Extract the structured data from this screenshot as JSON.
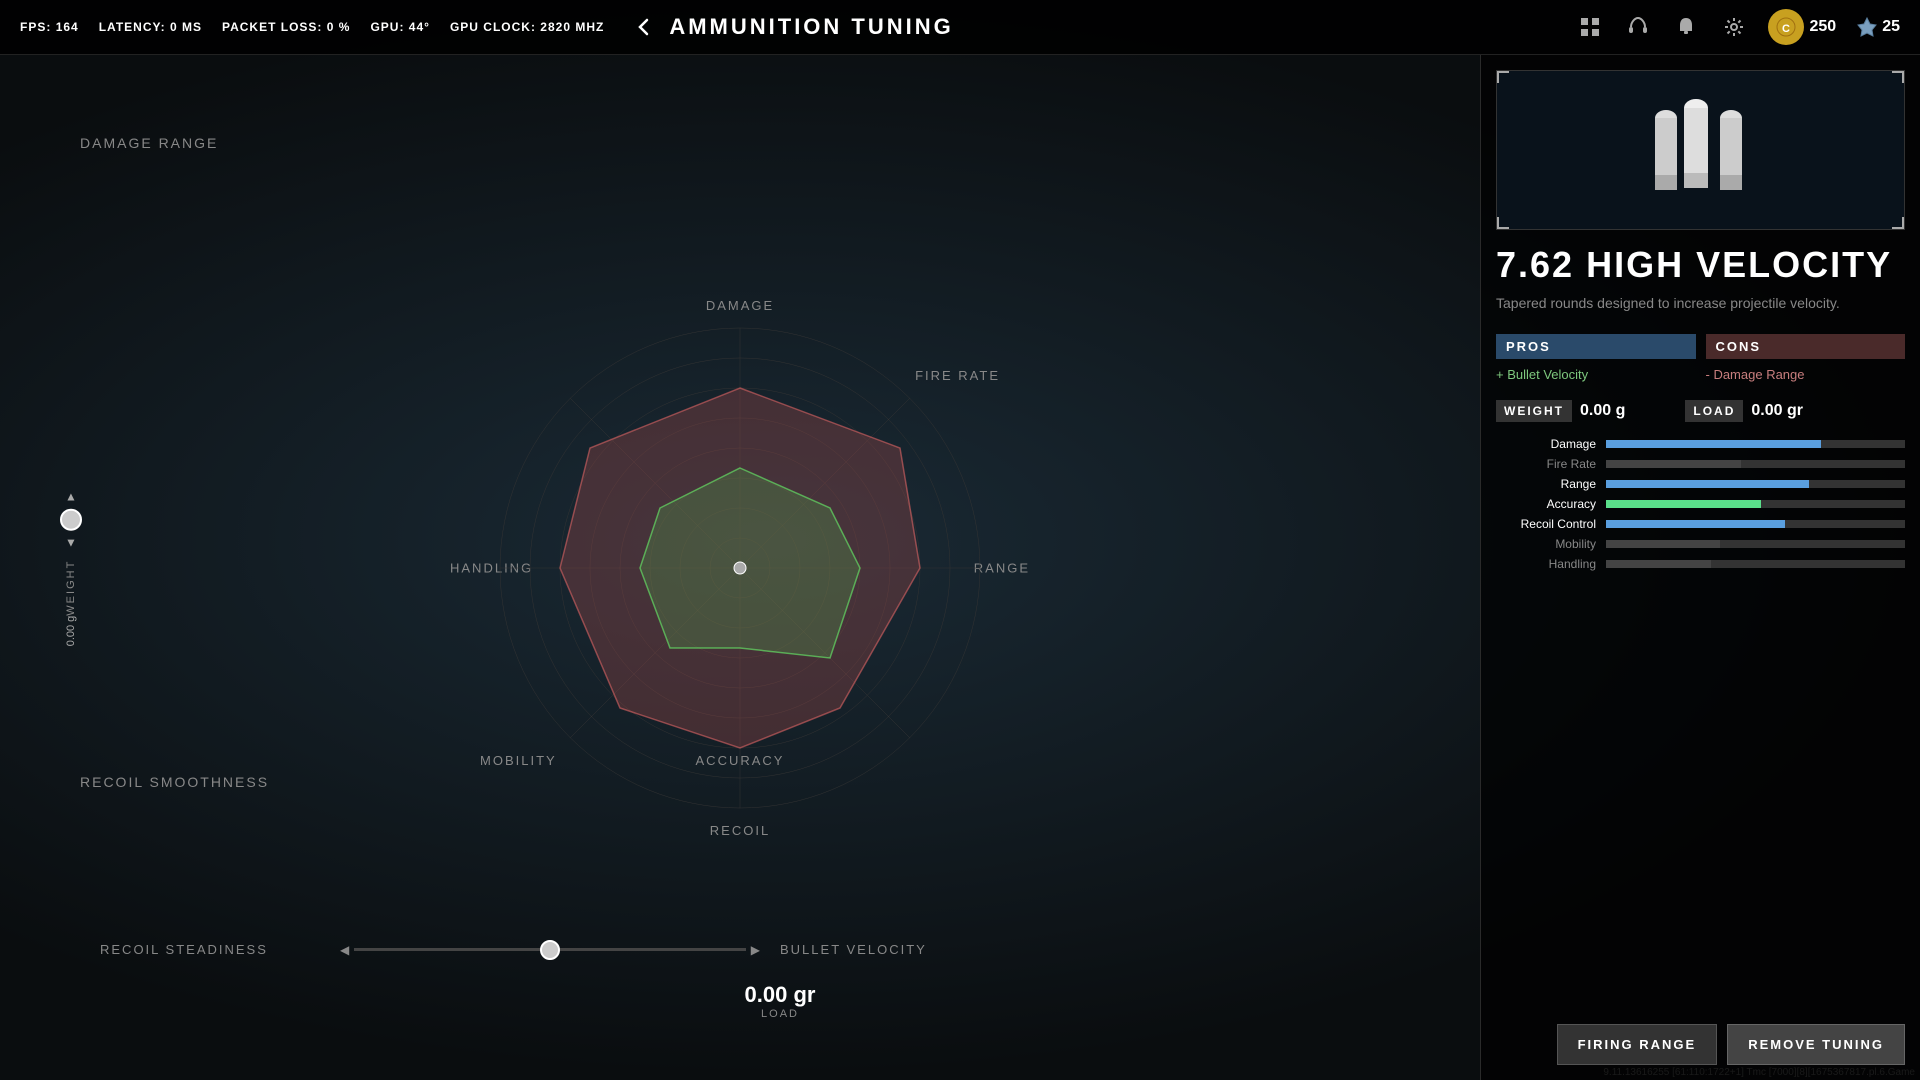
{
  "topbar": {
    "fps_label": "FPS:",
    "fps_value": "164",
    "latency_label": "LATENCY:",
    "latency_value": "0 MS",
    "packet_loss_label": "PACKET LOSS:",
    "packet_loss_value": "0 %",
    "gpu_label": "GPU:",
    "gpu_value": "44°",
    "gpu_clock_label": "GPU CLOCK:",
    "gpu_clock_value": "2820 MHZ",
    "page_title": "AMMUNITION TUNING",
    "currency1": "250",
    "currency2": "25"
  },
  "radar": {
    "labels": {
      "damage": "DAMAGE",
      "fire_rate": "FIRE RATE",
      "range": "RANGE",
      "accuracy": "ACCURACY",
      "recoil": "RECOIL",
      "mobility": "MOBILITY",
      "handling": "HANDLING"
    }
  },
  "left_panel": {
    "damage_range_label": "DAMAGE RANGE",
    "recoil_smoothness_label": "RECOIL SMOOTHNESS",
    "weight_label": "WEIGHT",
    "weight_value": "0.00",
    "weight_unit": "g",
    "recoil_steadiness_label": "RECOIL STEADINESS",
    "bullet_velocity_label": "BULLET VELOCITY",
    "load_value": "0.00 gr",
    "load_label": "LOAD"
  },
  "right_panel": {
    "ammo_name": "7.62 HIGH VELOCITY",
    "ammo_description": "Tapered rounds designed to increase projectile velocity.",
    "pros_header": "PROS",
    "cons_header": "CONS",
    "pros": [
      "+ Bullet Velocity"
    ],
    "cons": [
      "- Damage Range"
    ],
    "weight_label": "WEIGHT",
    "weight_value": "0.00",
    "weight_unit": "g",
    "load_label": "LOAD",
    "load_value": "0.00",
    "load_unit": "gr",
    "stats": [
      {
        "label": "Damage",
        "fill": 72,
        "active": true,
        "color": "blue"
      },
      {
        "label": "Fire Rate",
        "fill": 45,
        "active": false,
        "color": "blue"
      },
      {
        "label": "Range",
        "fill": 68,
        "active": true,
        "color": "blue"
      },
      {
        "label": "Accuracy",
        "fill": 52,
        "active": true,
        "color": "green"
      },
      {
        "label": "Recoil Control",
        "fill": 60,
        "active": true,
        "color": "blue"
      },
      {
        "label": "Mobility",
        "fill": 38,
        "active": false,
        "color": "blue"
      },
      {
        "label": "Handling",
        "fill": 35,
        "active": false,
        "color": "blue"
      }
    ],
    "btn_firing_range": "FIRING RANGE",
    "btn_remove_tuning": "REMOVE TUNING"
  },
  "debug": {
    "text": "9.11.13616255 [61:110:1722+1] Tmc [7000][8][1675367817.pl.6.Game"
  }
}
